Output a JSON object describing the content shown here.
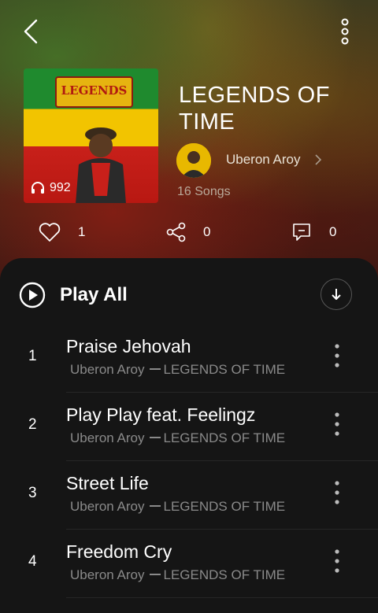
{
  "album": {
    "title": "LEGENDS OF TIME",
    "artist": "Uberon Aroy",
    "song_count": "16 Songs",
    "plays": "992",
    "cover_logo_text": "LEGENDS"
  },
  "stats": {
    "likes": "1",
    "shares": "0",
    "comments": "0"
  },
  "play_all_label": "Play All",
  "tracks": [
    {
      "num": "1",
      "title": "Praise Jehovah",
      "artist": "Uberon Aroy",
      "album": "LEGENDS OF TIME"
    },
    {
      "num": "2",
      "title": "Play Play feat. Feelingz",
      "artist": "Uberon Aroy",
      "album": "LEGENDS OF TIME"
    },
    {
      "num": "3",
      "title": "Street Life",
      "artist": "Uberon Aroy",
      "album": "LEGENDS OF TIME"
    },
    {
      "num": "4",
      "title": "Freedom Cry",
      "artist": "Uberon Aroy",
      "album": "LEGENDS OF TIME"
    }
  ],
  "icons": [
    "back-icon",
    "more-vertical-icon",
    "headphones-icon",
    "heart-icon",
    "share-icon",
    "comment-icon",
    "play-circle-icon",
    "download-icon",
    "chevron-right-icon"
  ]
}
